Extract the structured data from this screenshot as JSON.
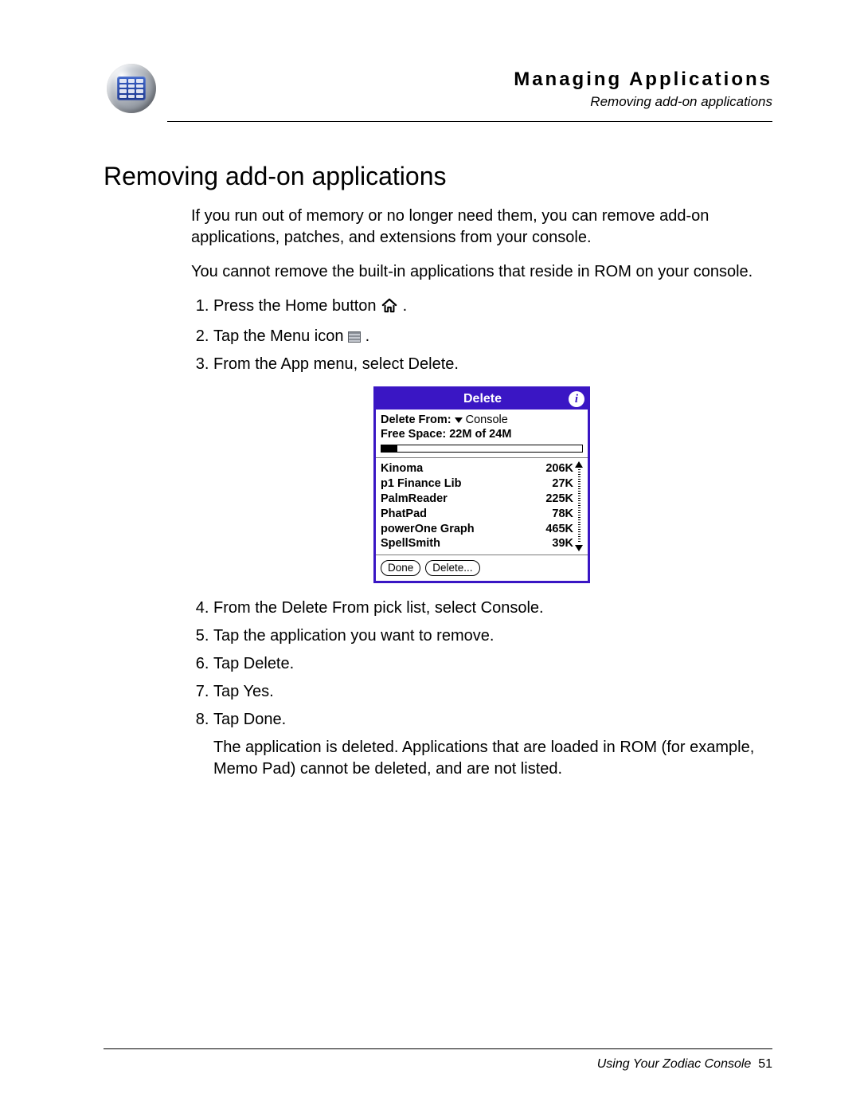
{
  "header": {
    "chapter_title": "Managing Applications",
    "chapter_sub": "Removing add-on applications"
  },
  "section": {
    "title": "Removing add-on applications",
    "intro_p1": "If you run out of memory or no longer need them, you can remove add-on applications, patches, and extensions from your console.",
    "intro_p2": "You cannot remove the built-in applications that reside in ROM on your console."
  },
  "steps": {
    "s1_before": "Press the Home button ",
    "s1_after": ".",
    "s2_before": "Tap the Menu icon ",
    "s2_after": ".",
    "s3": "From the App menu, select Delete.",
    "s4": "From the Delete From pick list, select Console.",
    "s5": "Tap the application you want to remove.",
    "s6": "Tap Delete.",
    "s7": "Tap Yes.",
    "s8": "Tap Done.",
    "outro": "The application is deleted. Applications that are loaded in ROM (for example, Memo Pad) cannot be deleted, and are not listed."
  },
  "dialog": {
    "title": "Delete",
    "info_glyph": "i",
    "delete_from_label": "Delete From:",
    "delete_from_value": "Console",
    "free_space_label": "Free Space: 22M of 24M",
    "space_fill_percent": 8,
    "apps": [
      {
        "name": "Kinoma",
        "size": "206K"
      },
      {
        "name": "p1 Finance Lib",
        "size": "27K"
      },
      {
        "name": "PalmReader",
        "size": "225K"
      },
      {
        "name": "PhatPad",
        "size": "78K"
      },
      {
        "name": "powerOne Graph",
        "size": "465K"
      },
      {
        "name": "SpellSmith",
        "size": "39K"
      }
    ],
    "btn_done": "Done",
    "btn_delete": "Delete..."
  },
  "footer": {
    "book": "Using Your Zodiac Console",
    "page": "51"
  }
}
